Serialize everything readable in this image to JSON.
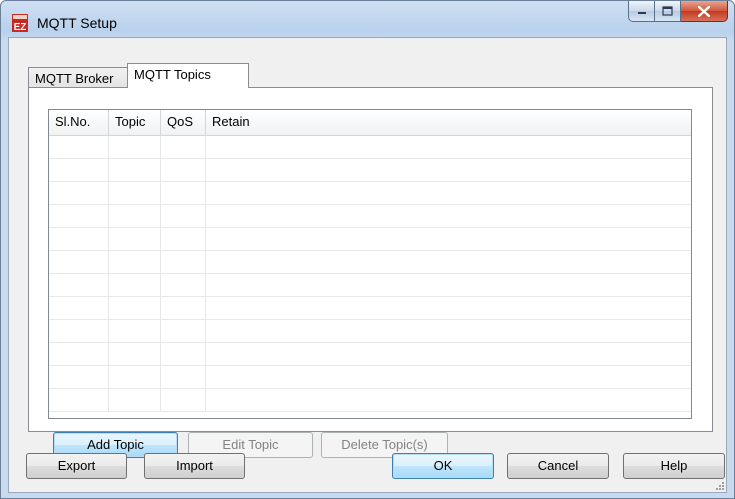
{
  "window": {
    "title": "MQTT Setup",
    "app_icon_text": "EZ"
  },
  "tabs": [
    {
      "label": "MQTT Broker",
      "selected": false
    },
    {
      "label": "MQTT Topics",
      "selected": true
    }
  ],
  "topics_table": {
    "columns": [
      "Sl.No.",
      "Topic",
      "QoS",
      "Retain"
    ],
    "rows": []
  },
  "panel_buttons": {
    "add": "Add Topic",
    "edit": "Edit Topic",
    "delete": "Delete Topic(s)"
  },
  "footer_buttons": {
    "export": "Export",
    "import": "Import",
    "ok": "OK",
    "cancel": "Cancel",
    "help": "Help"
  },
  "colors": {
    "title_bar": "#b9d1ec",
    "close_button": "#c8452b",
    "default_button_border": "#3c7fb1"
  }
}
